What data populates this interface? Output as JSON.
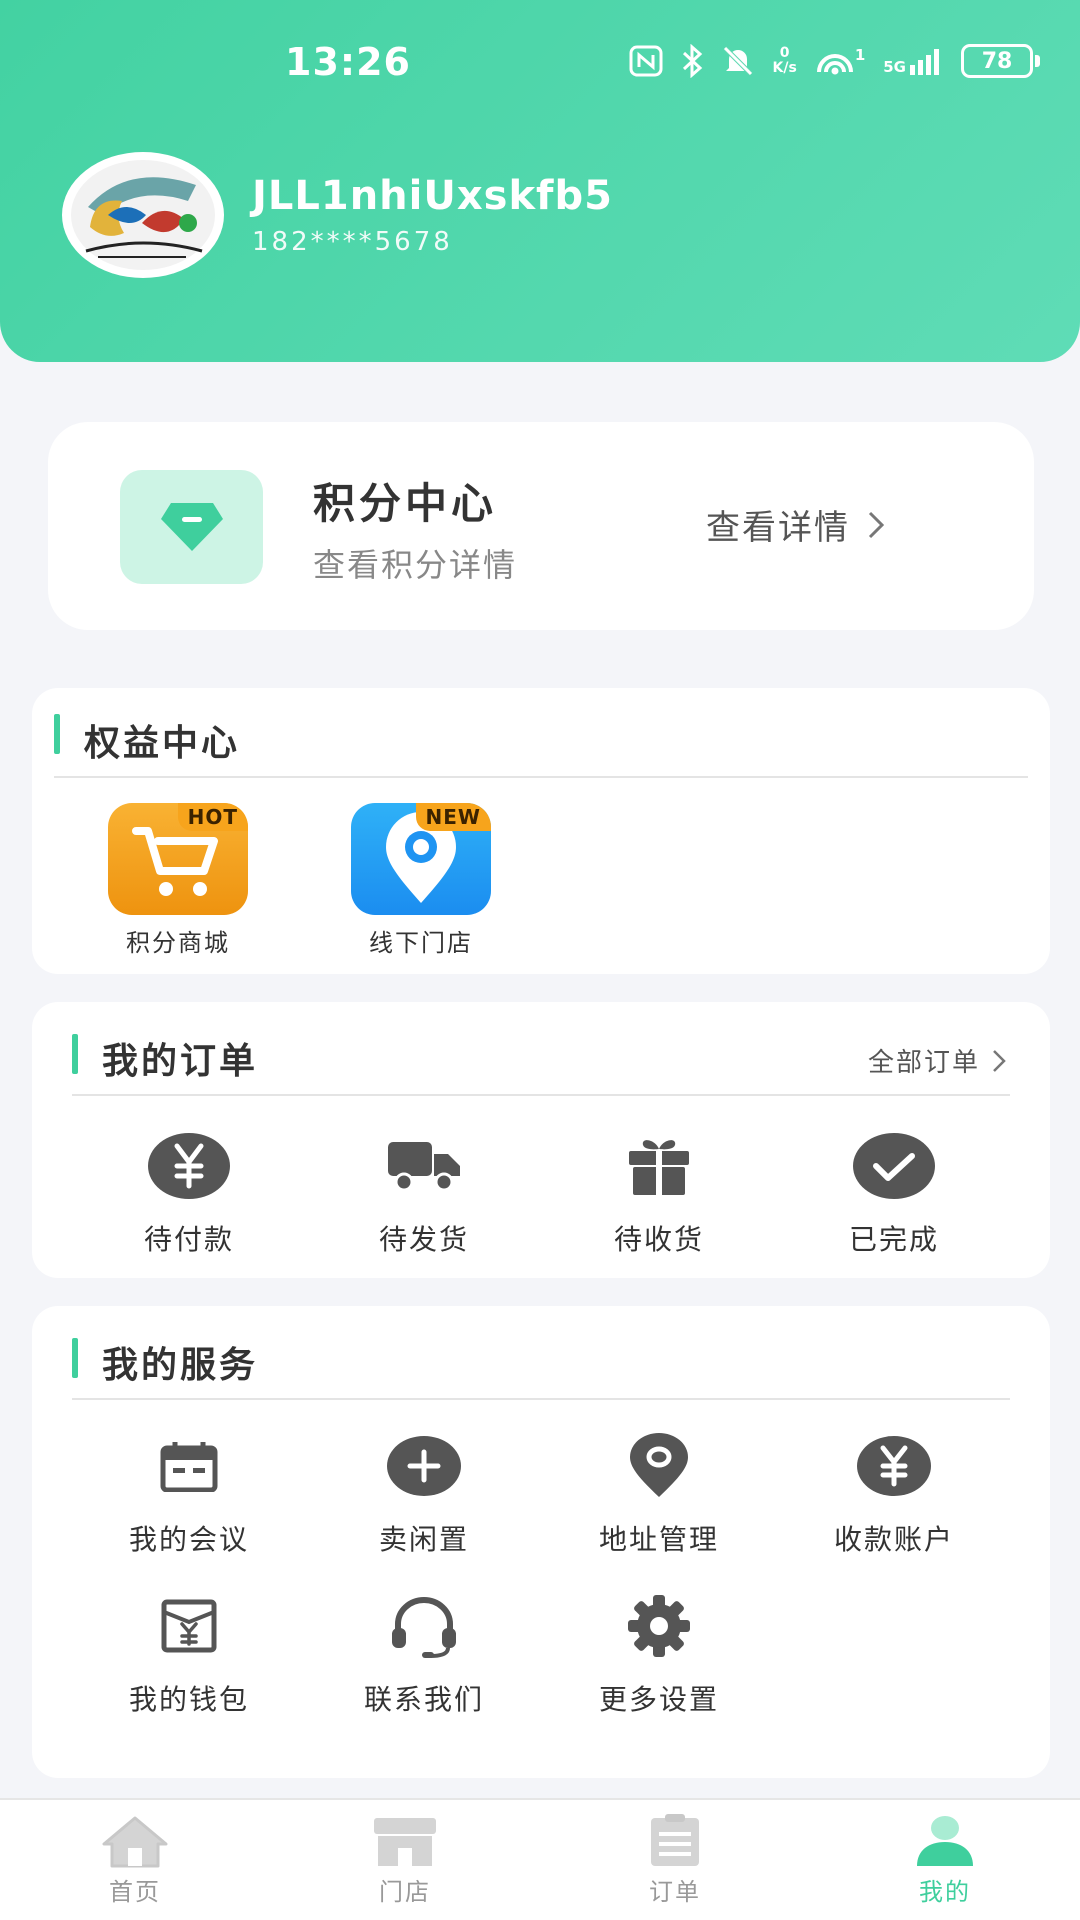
{
  "status_bar": {
    "time": "13:26",
    "net_speed_value": "0",
    "net_speed_unit": "K/s",
    "hotspot_count": "1",
    "network": "5G",
    "battery": "78"
  },
  "profile": {
    "username": "JLL1nhiUxskfb5",
    "phone": "182****5678"
  },
  "points": {
    "title": "积分中心",
    "subtitle": "查看积分详情",
    "link_label": "查看详情",
    "icon": "diamond-icon"
  },
  "rights": {
    "title": "权益中心",
    "items": [
      {
        "label": "积分商城",
        "badge": "HOT",
        "icon": "cart-icon",
        "color": "#f5a623"
      },
      {
        "label": "线下门店",
        "badge": "NEW",
        "icon": "map-pin-icon",
        "color": "#2a9cf5"
      }
    ]
  },
  "orders": {
    "title": "我的订单",
    "all_label": "全部订单",
    "items": [
      {
        "label": "待付款",
        "icon": "yuan-circle-icon"
      },
      {
        "label": "待发货",
        "icon": "truck-icon"
      },
      {
        "label": "待收货",
        "icon": "gift-icon"
      },
      {
        "label": "已完成",
        "icon": "check-circle-icon"
      }
    ]
  },
  "services": {
    "title": "我的服务",
    "items": [
      {
        "label": "我的会议",
        "icon": "calendar-icon"
      },
      {
        "label": "卖闲置",
        "icon": "plus-circle-icon"
      },
      {
        "label": "地址管理",
        "icon": "location-icon"
      },
      {
        "label": "收款账户",
        "icon": "yuan-circle-icon"
      },
      {
        "label": "我的钱包",
        "icon": "wallet-icon"
      },
      {
        "label": "联系我们",
        "icon": "headset-icon"
      },
      {
        "label": "更多设置",
        "icon": "gear-icon"
      }
    ]
  },
  "tabbar": {
    "items": [
      {
        "label": "首页",
        "icon": "home-icon"
      },
      {
        "label": "门店",
        "icon": "store-icon"
      },
      {
        "label": "订单",
        "icon": "order-list-icon"
      },
      {
        "label": "我的",
        "icon": "user-icon",
        "active": true
      }
    ]
  },
  "colors": {
    "accent": "#3fcf9d",
    "header_gradient_start": "#43d2a2",
    "header_gradient_end": "#5fdcb6",
    "icon_gray": "#555555"
  }
}
